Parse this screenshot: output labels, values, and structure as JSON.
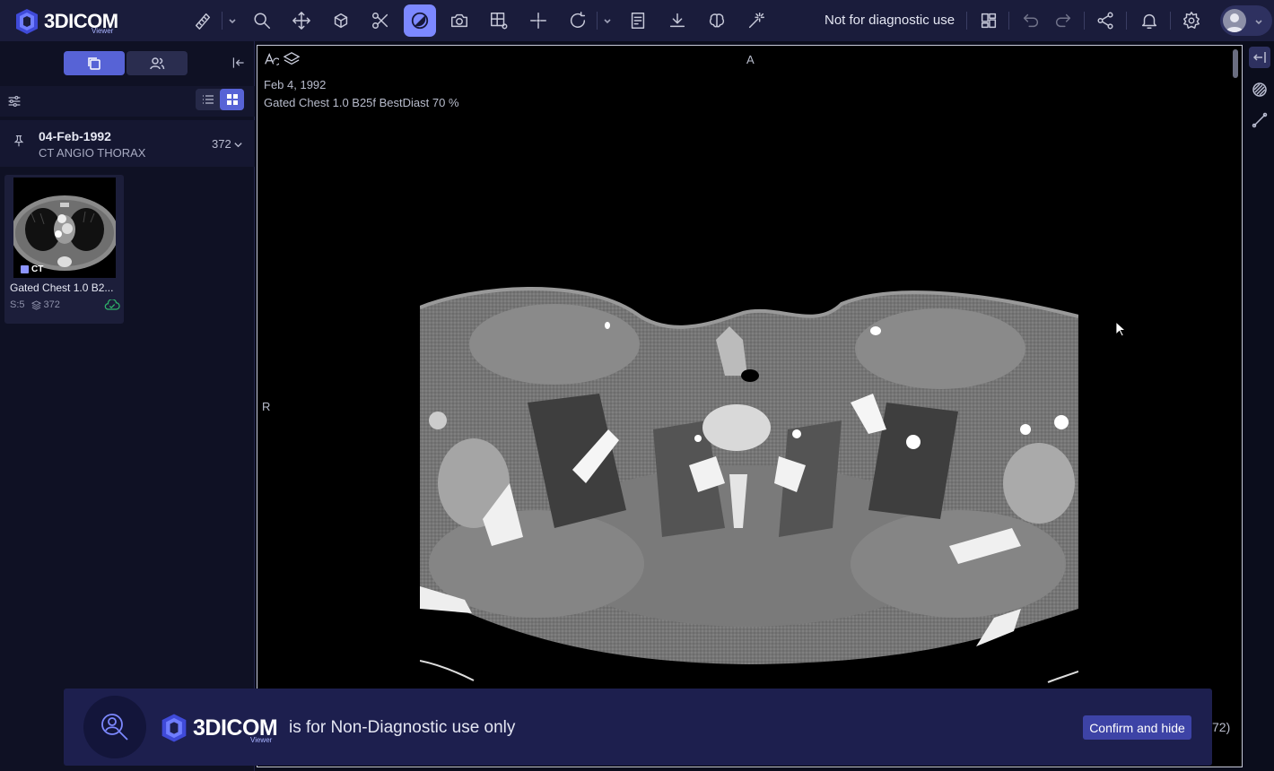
{
  "app": {
    "logo_text": "3DICOM",
    "logo_sub": "Viewer",
    "disclaimer": "Not for diagnostic use"
  },
  "toolbar": {
    "icons": [
      "ruler-icon",
      "zoom-icon",
      "pan-icon",
      "rotate-3d-icon",
      "scissors-icon",
      "contrast-icon",
      "camera-icon",
      "layout-settings-icon",
      "crosshair-icon",
      "rotate-icon",
      "report-icon",
      "download-icon",
      "brain-icon",
      "magic-wand-icon",
      "grid-layout-icon",
      "undo-icon",
      "redo-icon",
      "share-icon",
      "bell-icon",
      "settings-icon",
      "avatar"
    ],
    "active": "contrast-icon"
  },
  "sidebar": {
    "study": {
      "date": "04-Feb-1992",
      "description": "CT ANGIO THORAX",
      "count": "372"
    },
    "series": [
      {
        "modality": "CT",
        "name": "Gated Chest 1.0 B2...",
        "series_number": "S:5",
        "images": "372"
      }
    ]
  },
  "viewport": {
    "date": "Feb 4, 1992",
    "series_description": "Gated Chest 1.0 B25f BestDiast 70 %",
    "orientation_top": "A",
    "orientation_left": "R",
    "counter_fragment": "72)"
  },
  "banner": {
    "logo_text": "3DICOM",
    "logo_sub": "Viewer",
    "message": "is for Non-Diagnostic use only",
    "confirm_label": "Confirm and hide"
  },
  "colors": {
    "accent": "#7c88ff",
    "topbar": "#1a1c3b",
    "banner": "#1d1f4e",
    "cloud_ok": "#2fb36b"
  }
}
